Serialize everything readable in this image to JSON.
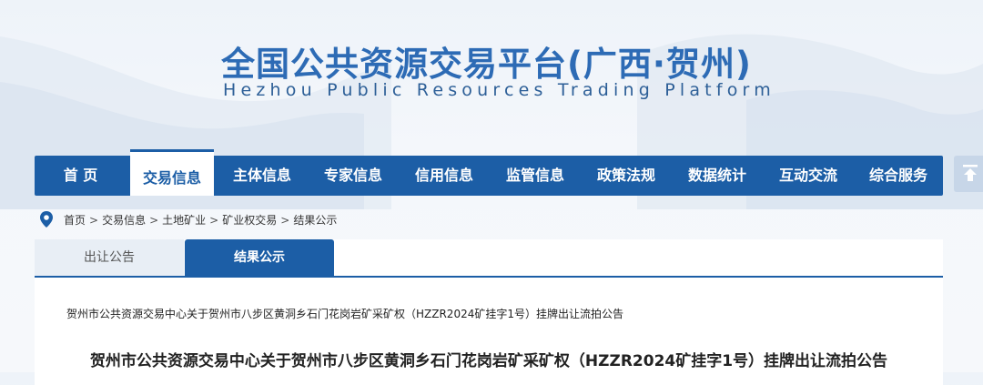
{
  "header": {
    "title": "全国公共资源交易平台(广西·贺州)",
    "subtitle": "Hezhou Public Resources Trading Platform"
  },
  "nav": {
    "items": [
      {
        "label": "首 页",
        "active": false
      },
      {
        "label": "交易信息",
        "active": true
      },
      {
        "label": "主体信息",
        "active": false
      },
      {
        "label": "专家信息",
        "active": false
      },
      {
        "label": "信用信息",
        "active": false
      },
      {
        "label": "监管信息",
        "active": false
      },
      {
        "label": "政策法规",
        "active": false
      },
      {
        "label": "数据统计",
        "active": false
      },
      {
        "label": "互动交流",
        "active": false
      },
      {
        "label": "综合服务",
        "active": false
      }
    ]
  },
  "breadcrumb": {
    "icon": "location-pin-icon",
    "items": [
      "首页",
      "交易信息",
      "土地矿业",
      "矿业权交易",
      "结果公示"
    ],
    "separator": ">"
  },
  "tabs": [
    {
      "label": "出让公告",
      "active": false
    },
    {
      "label": "结果公示",
      "active": true
    }
  ],
  "announcement": {
    "list_title": "贺州市公共资源交易中心关于贺州市八步区黄洞乡石门花岗岩矿采矿权（HZZR2024矿挂字1号）挂牌出让流拍公告",
    "heading": "贺州市公共资源交易中心关于贺州市八步区黄洞乡石门花岗岩矿采矿权（HZZR2024矿挂字1号）挂牌出让流拍公告"
  },
  "colors": {
    "primary": "#1c5ea6",
    "title": "#2d6bb5",
    "background": "#f4f7fb"
  }
}
